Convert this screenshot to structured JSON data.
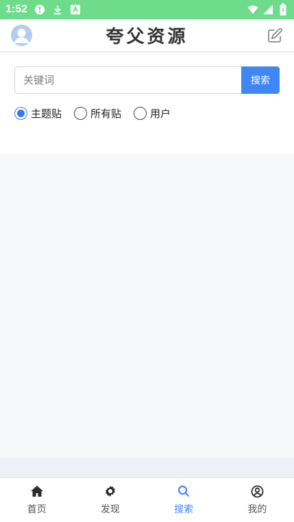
{
  "status_bar": {
    "time": "1:52",
    "icons": [
      "alert-icon",
      "download-icon",
      "a-icon",
      "wifi-icon",
      "signal-icon",
      "battery-icon"
    ]
  },
  "header": {
    "title": "夸父资源",
    "avatar_icon": "avatar-icon",
    "edit_icon": "edit-icon"
  },
  "search": {
    "placeholder": "关键词",
    "value": "",
    "button_label": "搜索",
    "options": [
      {
        "label": "主题贴",
        "checked": true
      },
      {
        "label": "所有贴",
        "checked": false
      },
      {
        "label": "用户",
        "checked": false
      }
    ]
  },
  "tabbar": {
    "items": [
      {
        "label": "首页",
        "icon": "home-icon",
        "active": false
      },
      {
        "label": "发现",
        "icon": "gear-icon",
        "active": false
      },
      {
        "label": "搜索",
        "icon": "search-icon",
        "active": true
      },
      {
        "label": "我的",
        "icon": "user-circle-icon",
        "active": false
      }
    ]
  },
  "colors": {
    "status_bar": "#6fdc8c",
    "accent": "#3f87f5",
    "background": "#f7f8fa"
  }
}
